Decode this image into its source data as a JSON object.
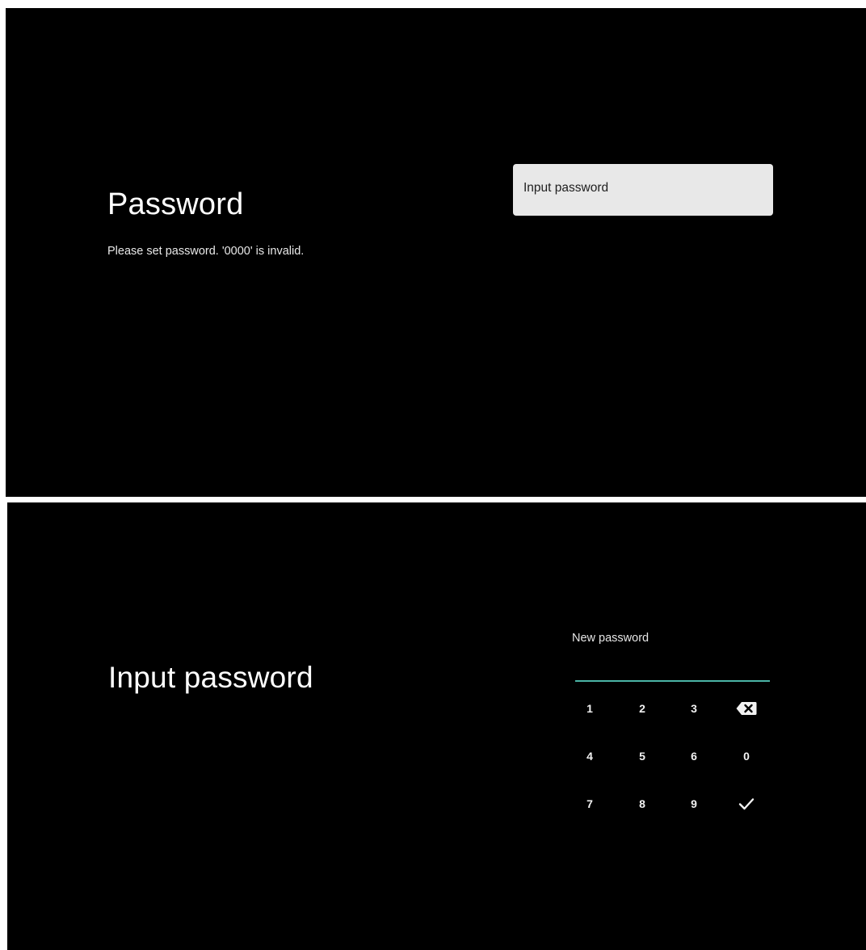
{
  "password_screen": {
    "title": "Password",
    "description": "Please set password. '0000' is invalid.",
    "option_label": "Input password"
  },
  "input_screen": {
    "title": "Input password",
    "field_label": "New password",
    "keypad": {
      "row1": [
        "1",
        "2",
        "3"
      ],
      "row2": [
        "4",
        "5",
        "6",
        "0"
      ],
      "row3": [
        "7",
        "8",
        "9"
      ],
      "backspace_icon": "backspace-icon",
      "confirm_icon": "check-icon"
    }
  },
  "colors": {
    "background": "#000000",
    "option_highlight": "#e8e8e8",
    "field_underline": "#4bb4a6"
  }
}
